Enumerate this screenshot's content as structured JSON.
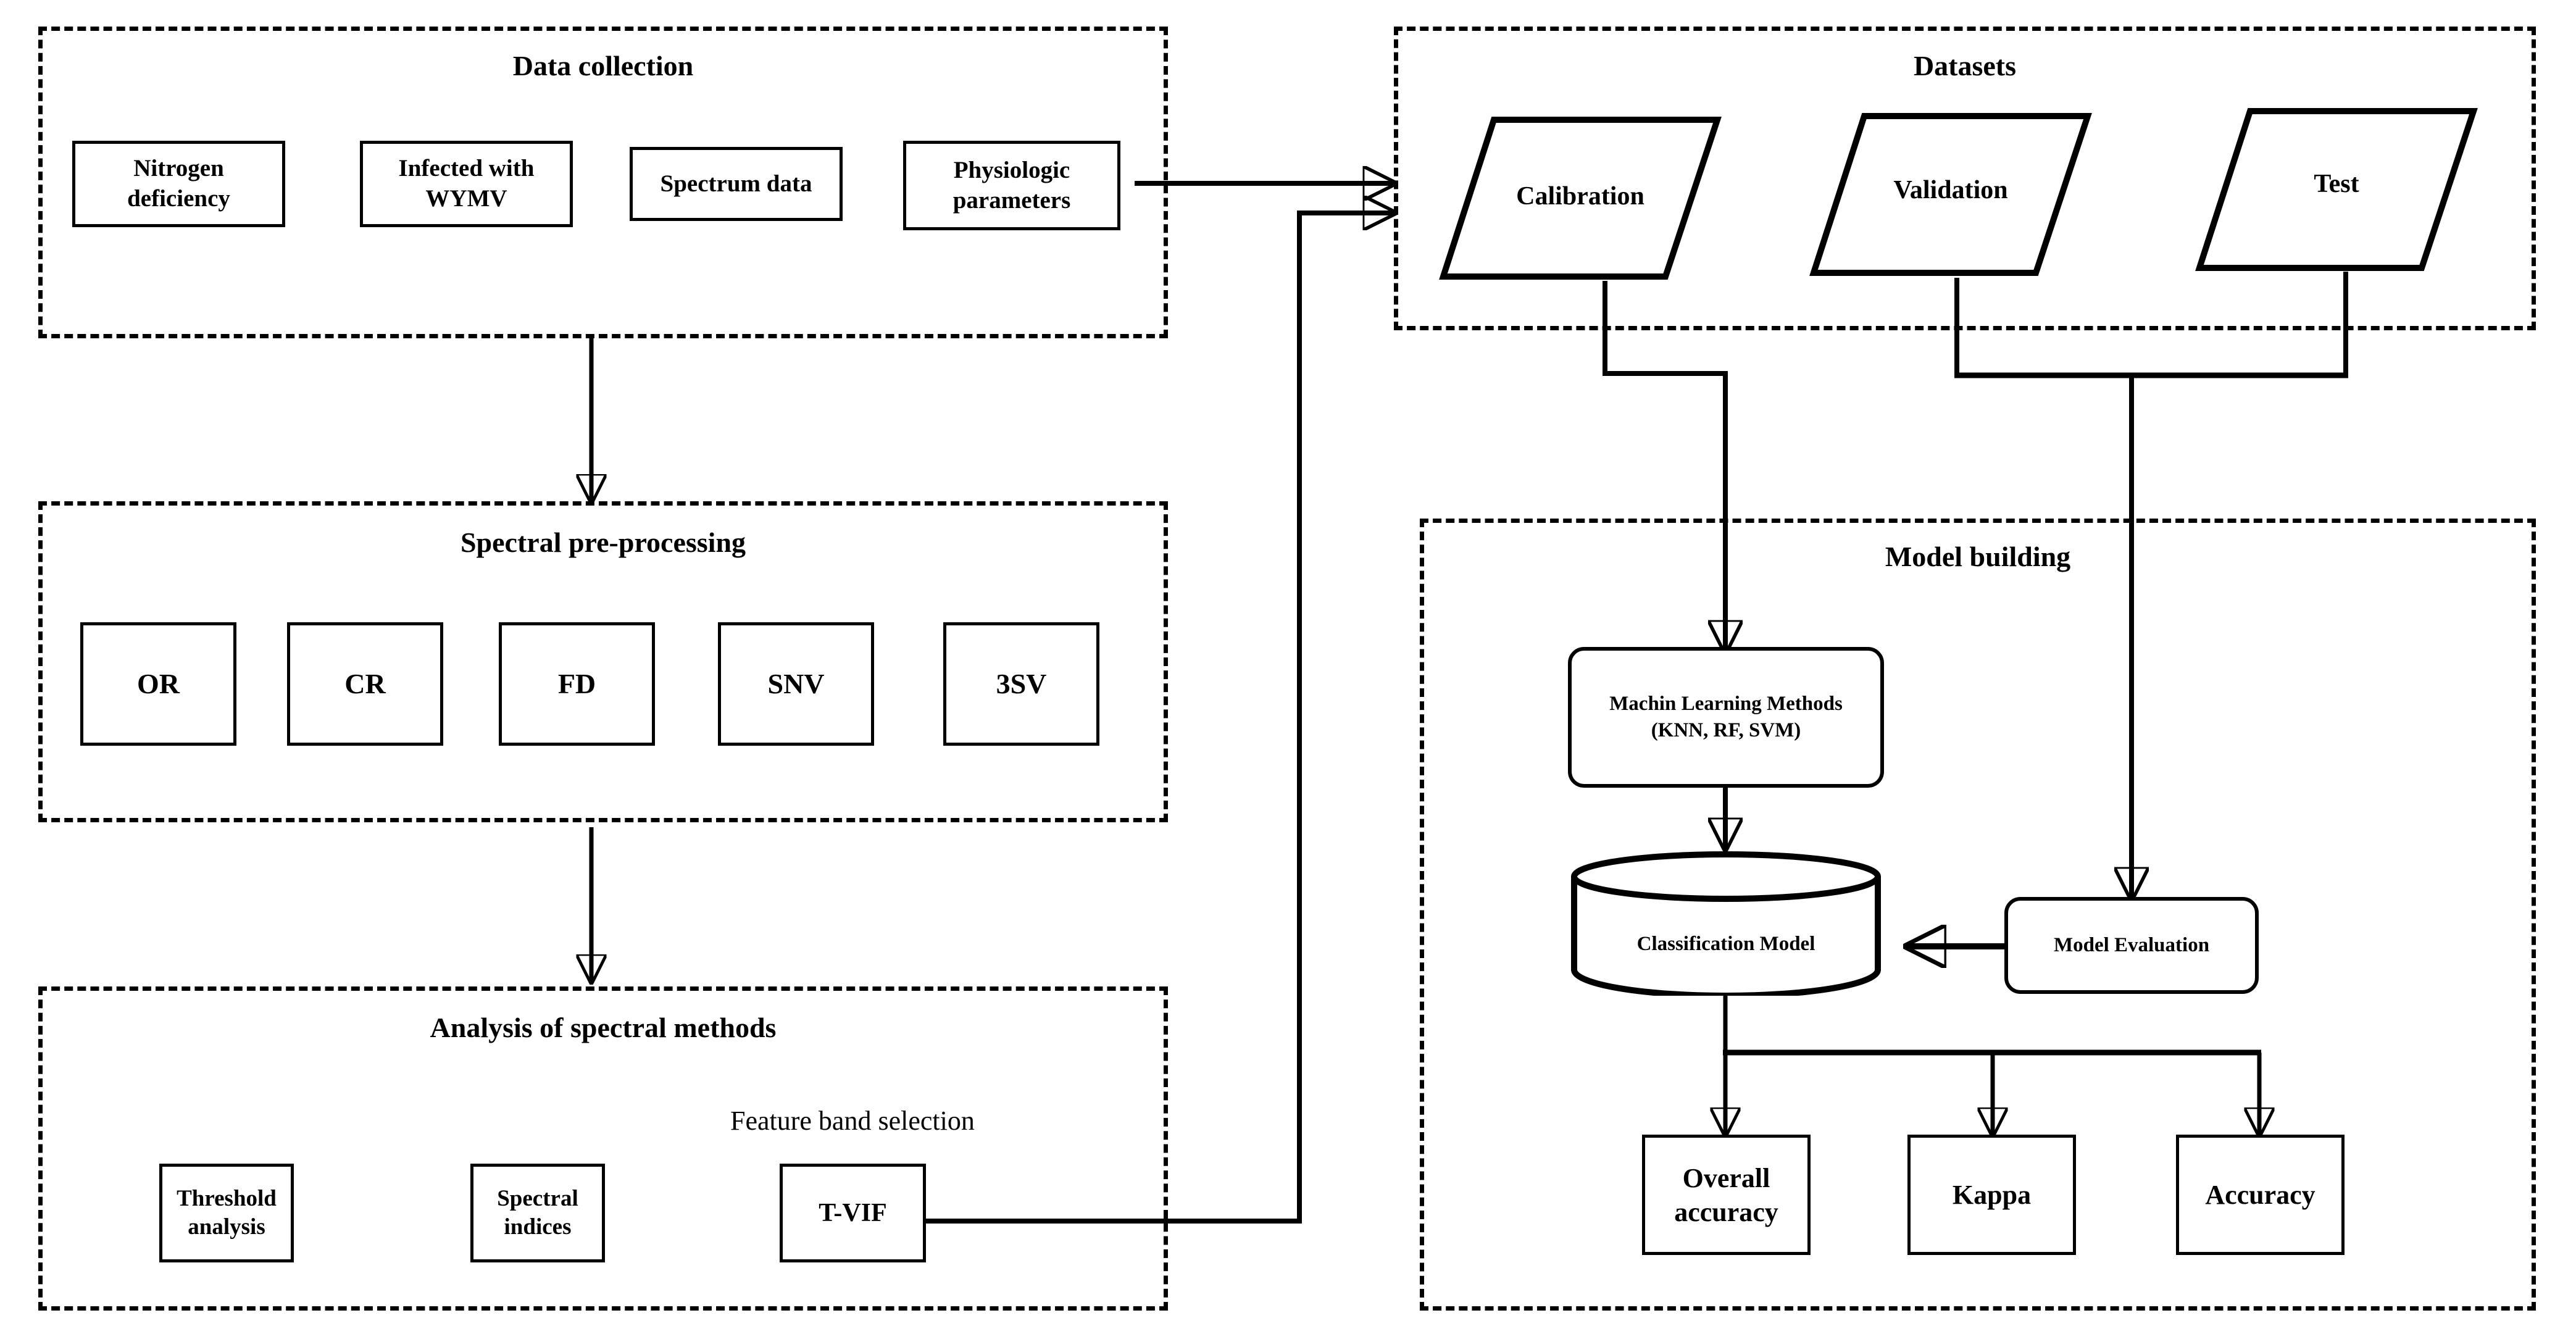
{
  "figure": {
    "type": "flowchart",
    "background": "#ffffff",
    "line_color": "#000000"
  },
  "panels": [
    {
      "id": "data-collection",
      "title": "Data collection",
      "nodes": [
        {
          "id": "nitrogen-deficiency",
          "label": "Nitrogen\ndeficiency",
          "shape": "rect"
        },
        {
          "id": "infected-wymv",
          "label": "Infected with\nWYMV",
          "shape": "rect"
        },
        {
          "id": "spectrum-data",
          "label": "Spectrum data",
          "shape": "rect"
        },
        {
          "id": "physiologic-parameters",
          "label": "Physiologic\nparameters",
          "shape": "rect"
        }
      ]
    },
    {
      "id": "spectral-pre-processing",
      "title": "Spectral pre-processing",
      "nodes": [
        {
          "id": "or",
          "label": "OR",
          "shape": "rect"
        },
        {
          "id": "cr",
          "label": "CR",
          "shape": "rect"
        },
        {
          "id": "fd",
          "label": "FD",
          "shape": "rect"
        },
        {
          "id": "snv",
          "label": "SNV",
          "shape": "rect"
        },
        {
          "id": "3sv",
          "label": "3SV",
          "shape": "rect"
        }
      ]
    },
    {
      "id": "analysis-of-spectral-methods",
      "title": "Analysis of spectral methods",
      "caption": "Feature band selection",
      "nodes": [
        {
          "id": "threshold-analysis",
          "label": "Threshold\nanalysis",
          "shape": "rect"
        },
        {
          "id": "spectral-indices",
          "label": "Spectral\nindices",
          "shape": "rect"
        },
        {
          "id": "t-vif",
          "label": "T-VIF",
          "shape": "rect"
        }
      ]
    },
    {
      "id": "datasets",
      "title": "Datasets",
      "nodes": [
        {
          "id": "calibration",
          "label": "Calibration",
          "shape": "parallelogram"
        },
        {
          "id": "validation",
          "label": "Validation",
          "shape": "parallelogram"
        },
        {
          "id": "test",
          "label": "Test",
          "shape": "parallelogram"
        }
      ]
    },
    {
      "id": "model-building",
      "title": "Model building",
      "nodes": [
        {
          "id": "machine-learning-methods",
          "label": "Machin Learning Methods\n(KNN, RF, SVM)",
          "shape": "rounded-rect"
        },
        {
          "id": "classification-model",
          "label": "Classification Model",
          "shape": "cylinder"
        },
        {
          "id": "model-evaluation",
          "label": "Model Evaluation",
          "shape": "rounded-rect"
        },
        {
          "id": "overall-accuracy",
          "label": "Overall\naccuracy",
          "shape": "rect"
        },
        {
          "id": "kappa",
          "label": "Kappa",
          "shape": "rect"
        },
        {
          "id": "accuracy",
          "label": "Accuracy",
          "shape": "rect"
        }
      ]
    }
  ],
  "labels": {
    "panel_data_collection": "Data collection",
    "panel_spectral_pre_processing": "Spectral pre-processing",
    "panel_analysis_of_spectral_methods": "Analysis of spectral methods",
    "panel_datasets": "Datasets",
    "panel_model_building": "Model building",
    "caption_feature_band_selection": "Feature band selection",
    "node_nitrogen_deficiency_l1": "Nitrogen",
    "node_nitrogen_deficiency_l2": "deficiency",
    "node_infected_wymv_l1": "Infected with",
    "node_infected_wymv_l2": "WYMV",
    "node_spectrum_data": "Spectrum data",
    "node_physiologic_parameters_l1": "Physiologic",
    "node_physiologic_parameters_l2": "parameters",
    "node_or": "OR",
    "node_cr": "CR",
    "node_fd": "FD",
    "node_snv": "SNV",
    "node_3sv": "3SV",
    "node_threshold_analysis_l1": "Threshold",
    "node_threshold_analysis_l2": "analysis",
    "node_spectral_indices_l1": "Spectral",
    "node_spectral_indices_l2": "indices",
    "node_t_vif": "T-VIF",
    "node_calibration": "Calibration",
    "node_validation": "Validation",
    "node_test": "Test",
    "node_ml_methods_l1": "Machin Learning Methods",
    "node_ml_methods_l2": "(KNN, RF, SVM)",
    "node_classification_model": "Classification Model",
    "node_model_evaluation": "Model Evaluation",
    "node_overall_accuracy_l1": "Overall",
    "node_overall_accuracy_l2": "accuracy",
    "node_kappa": "Kappa",
    "node_accuracy": "Accuracy"
  },
  "edges": [
    {
      "from": "data-collection",
      "to": "spectral-pre-processing"
    },
    {
      "from": "spectral-pre-processing",
      "to": "analysis-of-spectral-methods"
    },
    {
      "from": "physiologic-parameters",
      "to": "datasets"
    },
    {
      "from": "t-vif",
      "to": "datasets"
    },
    {
      "from": "calibration",
      "to": "machine-learning-methods"
    },
    {
      "from": "validation",
      "to": "model-evaluation"
    },
    {
      "from": "test",
      "to": "model-evaluation"
    },
    {
      "from": "machine-learning-methods",
      "to": "classification-model"
    },
    {
      "from": "model-evaluation",
      "to": "classification-model"
    },
    {
      "from": "classification-model",
      "to": "overall-accuracy"
    },
    {
      "from": "classification-model",
      "to": "kappa"
    },
    {
      "from": "classification-model",
      "to": "accuracy"
    }
  ]
}
